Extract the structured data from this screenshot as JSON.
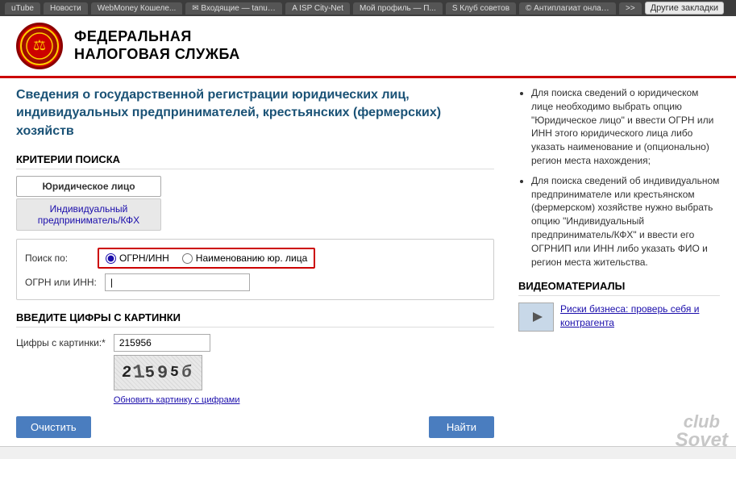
{
  "browser": {
    "tabs": [
      {
        "label": "uTube"
      },
      {
        "label": "Новости"
      },
      {
        "label": "WebMoney Кошеле..."
      },
      {
        "label": "✉ Входящие — tanuss..."
      },
      {
        "label": "A ISP City-Net"
      },
      {
        "label": "Мой профиль — П..."
      },
      {
        "label": "S Клуб советов"
      },
      {
        "label": "© Антиплагиат онлай..."
      },
      {
        "label": ">>"
      },
      {
        "label": "Другие закладки"
      }
    ]
  },
  "header": {
    "logo_alt": "ФНС логотип",
    "title_line1": "ФЕДЕРАЛЬНАЯ",
    "title_line2": "НАЛОГОВАЯ СЛУЖБА"
  },
  "page": {
    "title": "Сведения о государственной регистрации юридических лиц, индивидуальных предпринимателей, крестьянских (фермерских) хозяйств"
  },
  "search_section": {
    "heading": "КРИТЕРИИ ПОИСКА",
    "tab_legal": "Юридическое лицо",
    "tab_individual": "Индивидуальный предприниматель/КФХ",
    "search_by_label": "Поиск по:",
    "radio_ogrn": "ОГРН/ИНН",
    "radio_name": "Наименованию юр. лица",
    "ogrn_inn_label": "ОГРН или ИНН:",
    "ogrn_inn_value": "|"
  },
  "captcha_section": {
    "heading": "ВВЕДИТЕ ЦИФРЫ С КАРТИНКИ",
    "label": "Цифры с картинки:*",
    "value": "215956",
    "captcha_display": "21595б",
    "refresh_link": "Обновить картинку с цифрами"
  },
  "buttons": {
    "clear": "Очистить",
    "find": "Найти"
  },
  "right_panel": {
    "info_items": [
      "Для поиска сведений о юридическом лице необходимо выбрать опцию \"Юридическое лицо\" и ввести ОГРН или ИНН этого юридического лица либо указать наименование и (опционально) регион места нахождения;",
      "Для поиска сведений об индивидуальном предпринимателе или крестьянском (фермерском) хозяйстве нужно выбрать опцию \"Индивидуальный предприниматель/КФХ\" и ввести его ОГРНИП или ИНН либо указать ФИО и регион места жительства."
    ],
    "video_heading": "ВИДЕОМАТЕРИАЛЫ",
    "video_link": "Риски бизнеса: проверь себя и контрагента"
  },
  "watermark": {
    "line1": "club",
    "line2": "Sovet"
  }
}
